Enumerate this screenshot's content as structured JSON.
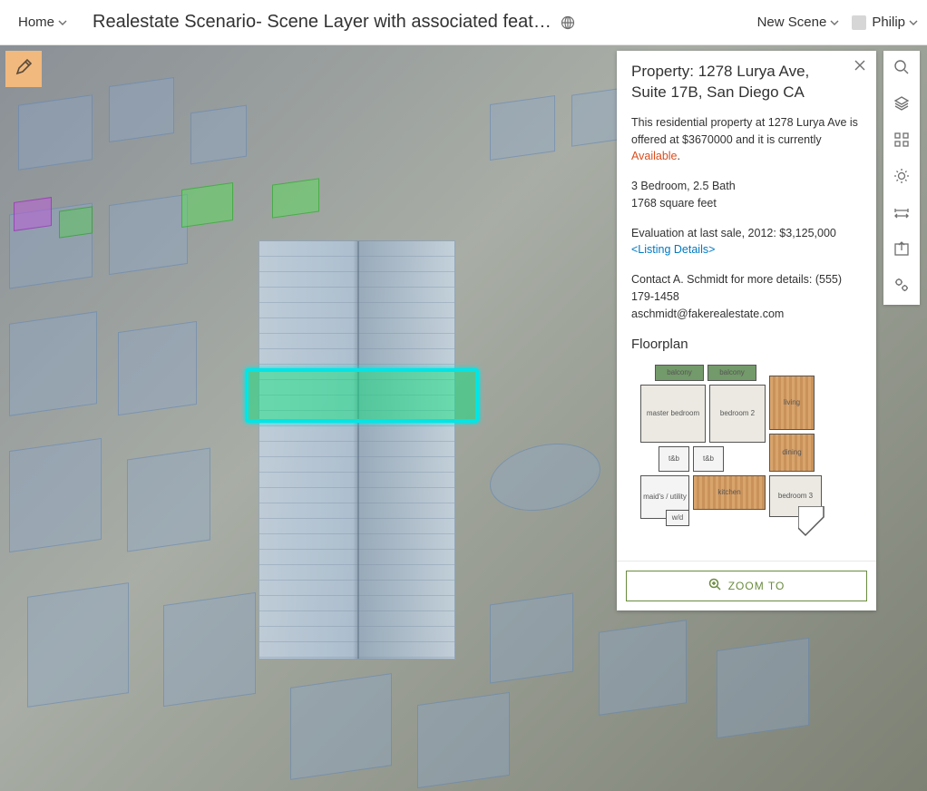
{
  "header": {
    "home_label": "Home",
    "title": "Realestate Scenario- Scene Layer with associated feat…",
    "scene_label": "New Scene",
    "user_name": "Philip"
  },
  "popup": {
    "title": "Property: 1278 Lurya Ave, Suite 17B, San Diego CA",
    "desc_prefix": "This residential property at 1278 Lurya Ave is offered at $3670000 and it is currently ",
    "availability": "Available",
    "desc_suffix": ".",
    "beds_baths": "3 Bedroom, 2.5 Bath",
    "sqft": "1768 square feet",
    "evaluation": " Evaluation at last sale, 2012: $3,125,000",
    "listing_link": "<Listing Details>",
    "contact": "Contact A. Schmidt for more details:  (555) 179-1458",
    "email": "aschmidt@fakerealestate.com",
    "floorplan_label": "Floorplan",
    "rooms": {
      "balcony1": "balcony",
      "balcony2": "balcony",
      "master": "master bedroom",
      "bed2": "bedroom 2",
      "living": "living",
      "dining": "dining",
      "tb1": "t&b",
      "tb2": "t&b",
      "kitchen": "kitchen",
      "maids": "maid's / utility",
      "wd": "w/d",
      "bed3": "bedroom 3"
    },
    "zoom_label": "ZOOM TO"
  },
  "toolbar": {
    "items": [
      "search",
      "layers",
      "basemap",
      "daylight",
      "measure",
      "share",
      "settings"
    ]
  }
}
